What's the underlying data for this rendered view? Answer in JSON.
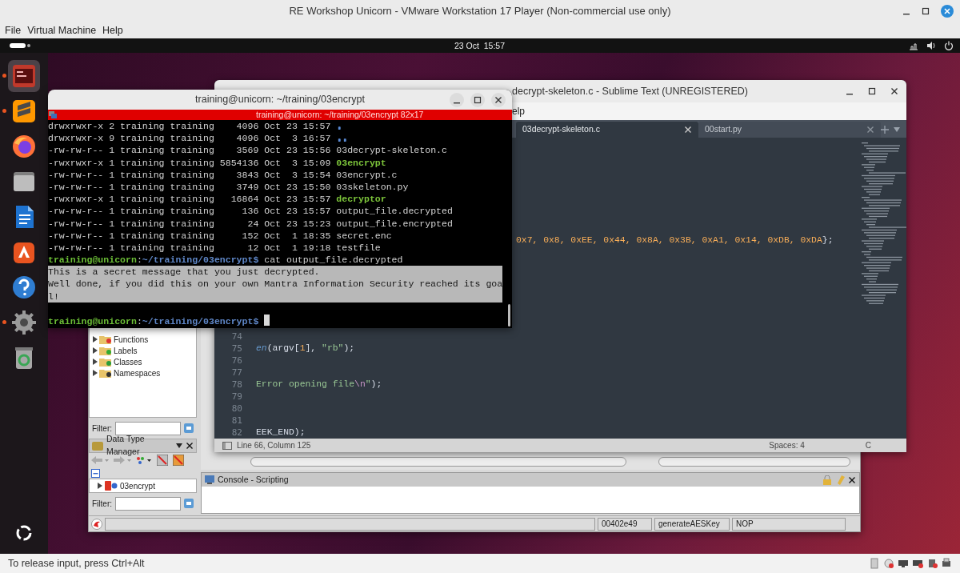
{
  "window": {
    "title": "RE Workshop Unicorn - VMware Workstation 17 Player (Non-commercial use only)"
  },
  "menu": [
    "File",
    "Virtual Machine",
    "Help"
  ],
  "top_bar": {
    "clock": "23 Oct  15:57"
  },
  "dock": [
    {
      "kind": "terminal",
      "selected": true,
      "running": true
    },
    {
      "kind": "sublime",
      "selected": false,
      "running": true
    },
    {
      "kind": "firefox",
      "selected": false,
      "running": false
    },
    {
      "kind": "files",
      "selected": false,
      "running": false
    },
    {
      "kind": "writer",
      "selected": false,
      "running": false
    },
    {
      "kind": "appcenter",
      "selected": false,
      "running": false
    },
    {
      "kind": "help",
      "selected": false,
      "running": false
    },
    {
      "kind": "settings",
      "selected": false,
      "running": true
    },
    {
      "kind": "trash",
      "selected": false,
      "running": false
    }
  ],
  "ghidra": {
    "tree": [
      {
        "label": "Functions",
        "kind": "functions"
      },
      {
        "label": "Labels",
        "kind": "labels"
      },
      {
        "label": "Classes",
        "kind": "classes"
      },
      {
        "label": "Namespaces",
        "kind": "namespaces"
      }
    ],
    "filter_label": "Filter:",
    "data_types": {
      "title": "Data Type Manager",
      "tree": [
        {
          "label": "03encrypt"
        }
      ],
      "filter_label": "Filter:"
    },
    "console": {
      "title": "Console - Scripting"
    },
    "status": [
      "00402e49",
      "generateAESKey",
      "NOP"
    ]
  },
  "sublime": {
    "title": "decrypt-skeleton.c - Sublime Text (UNREGISTERED)",
    "menu_fragment": "elp",
    "tabs": [
      {
        "label": "03decrypt-skeleton.c",
        "selected": true
      },
      {
        "label": "00start.py",
        "selected": false
      }
    ],
    "cut_line": [
      {
        "text": "0x7, 0x8, 0xEE, 0x44, 0x8A, 0x3B, 0xA1, 0x14, 0xDB, 0xDA",
        "kind": "number"
      },
      {
        "text": "};",
        "kind": "plain"
      }
    ],
    "lines": [
      {
        "number": "74"
      },
      {
        "number": "75",
        "tokens": [
          {
            "text": "en",
            "kind": "function"
          },
          {
            "text": "(argv[",
            "kind": "plain"
          },
          {
            "text": "1",
            "kind": "number"
          },
          {
            "text": "], ",
            "kind": "plain"
          },
          {
            "text": "\"rb\"",
            "kind": "string"
          },
          {
            "text": ");",
            "kind": "plain"
          }
        ]
      },
      {
        "number": "76"
      },
      {
        "number": "77"
      },
      {
        "number": "78",
        "tokens": [
          {
            "text": "Error opening file",
            "kind": "string"
          },
          {
            "text": "\\n",
            "kind": "escape"
          },
          {
            "text": "\"",
            "kind": "string"
          },
          {
            "text": ");",
            "kind": "plain"
          }
        ]
      },
      {
        "number": "79"
      },
      {
        "number": "80"
      },
      {
        "number": "81"
      },
      {
        "number": "82",
        "tokens": [
          {
            "text": "EEK_END);",
            "kind": "plain"
          }
        ]
      }
    ],
    "status": {
      "position": "Line 66, Column 125",
      "indent": "Spaces: 4",
      "syntax": "C"
    }
  },
  "terminal": {
    "title": "training@unicorn: ~/training/03encrypt",
    "tab": "training@unicorn: ~/training/03encrypt 82x17",
    "lines": [
      {
        "kind": "listing",
        "details": "drwxrwxr-x 2 training training    4096 Oct 23 15:57",
        "name": ".",
        "color": "#5b8bd6"
      },
      {
        "kind": "listing",
        "details": "drwxrwxr-x 9 training training    4096 Oct  3 16:57",
        "name": "..",
        "color": "#5b8bd6"
      },
      {
        "kind": "listing",
        "details": "-rw-rw-r-- 1 training training    3569 Oct 23 15:56",
        "name": "03decrypt-skeleton.c",
        "color": "#d3d3d3"
      },
      {
        "kind": "listing",
        "details": "-rwxrwxr-x 1 training training 5854136 Oct  3 15:09",
        "name": "03encrypt",
        "color": "#7cc43a"
      },
      {
        "kind": "listing",
        "details": "-rw-rw-r-- 1 training training    3843 Oct  3 15:54",
        "name": "03encrypt.c",
        "color": "#d3d3d3"
      },
      {
        "kind": "listing",
        "details": "-rw-rw-r-- 1 training training    3749 Oct 23 15:50",
        "name": "03skeleton.py",
        "color": "#d3d3d3"
      },
      {
        "kind": "listing",
        "details": "-rwxrwxr-x 1 training training   16864 Oct 23 15:57",
        "name": "decryptor",
        "color": "#7cc43a"
      },
      {
        "kind": "listing",
        "details": "-rw-rw-r-- 1 training training     136 Oct 23 15:57",
        "name": "output_file.decrypted",
        "color": "#d3d3d3"
      },
      {
        "kind": "listing",
        "details": "-rw-rw-r-- 1 training training      24 Oct 23 15:23",
        "name": "output_file.encrypted",
        "color": "#d3d3d3"
      },
      {
        "kind": "listing",
        "details": "-rw-rw-r-- 1 training training     152 Oct  1 18:35",
        "name": "secret.enc",
        "color": "#d3d3d3"
      },
      {
        "kind": "listing",
        "details": "-rw-rw-r-- 1 training training      12 Oct  1 19:18",
        "name": "testfile",
        "color": "#d3d3d3"
      },
      {
        "kind": "prompt",
        "user": "training@unicorn",
        "separator": ":",
        "path": "~/training/03encrypt$",
        "command": "cat output_file.decrypted"
      },
      {
        "kind": "output",
        "text": "This is a secret message that you just decrypted.",
        "selected": true
      },
      {
        "kind": "output",
        "text": "Well done, if you did this on your own Mantra Information Security reached its goa",
        "selected": true
      },
      {
        "kind": "output",
        "text": "l!",
        "selected": true
      },
      {
        "kind": "blank"
      },
      {
        "kind": "prompt",
        "user": "training@unicorn",
        "separator": ":",
        "path": "~/training/03encrypt$",
        "cursor": true
      }
    ]
  },
  "status_bar": {
    "hint": "To release input, press Ctrl+Alt"
  }
}
